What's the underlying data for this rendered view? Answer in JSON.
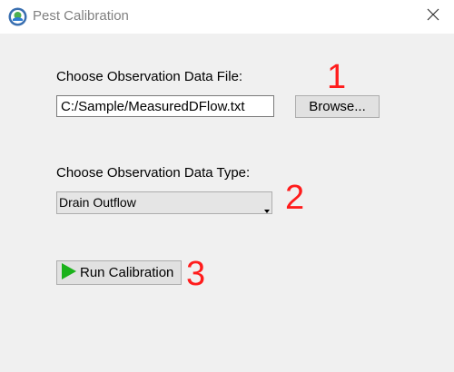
{
  "window": {
    "title": "Pest Calibration",
    "icon": "epa-seal-icon",
    "close_icon": "close-icon"
  },
  "file_section": {
    "label": "Choose Observation Data File:",
    "file_path_value": "C:/Sample/MeasuredDFlow.txt",
    "browse_label": "Browse..."
  },
  "type_section": {
    "label": "Choose Observation Data Type:",
    "selected_type": "Drain Outflow"
  },
  "run_button": {
    "label": "Run Calibration",
    "icon": "play-icon",
    "icon_color": "#1bb21b"
  },
  "annotations": {
    "step1": "1",
    "step2": "2",
    "step3": "3",
    "color": "#ff1c1c"
  }
}
